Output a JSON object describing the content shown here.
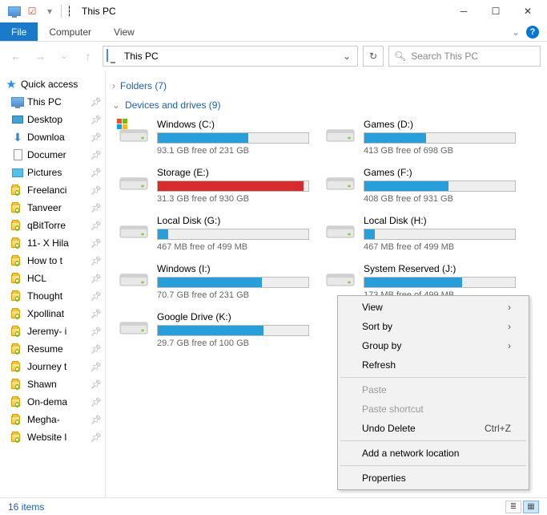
{
  "window": {
    "title": "This PC"
  },
  "ribbon": {
    "file": "File",
    "computer": "Computer",
    "view": "View"
  },
  "nav": {
    "address": "This PC",
    "search_placeholder": "Search This PC"
  },
  "sidebar": {
    "quick_access": "Quick access",
    "items": [
      {
        "label": "This PC",
        "type": "pc",
        "pin": true
      },
      {
        "label": "Desktop",
        "type": "desktop",
        "pin": true
      },
      {
        "label": "Downloa",
        "type": "down",
        "pin": true
      },
      {
        "label": "Documer",
        "type": "doc",
        "pin": true
      },
      {
        "label": "Pictures",
        "type": "pic",
        "pin": true
      },
      {
        "label": "Freelanci",
        "type": "folder",
        "pin": true
      },
      {
        "label": "Tanveer",
        "type": "folder",
        "pin": true
      },
      {
        "label": "qBitTorre",
        "type": "folder",
        "pin": true
      },
      {
        "label": "11- X Hila",
        "type": "folder",
        "pin": true
      },
      {
        "label": "How to t",
        "type": "folder",
        "pin": true
      },
      {
        "label": "HCL",
        "type": "folder",
        "pin": true
      },
      {
        "label": "Thought",
        "type": "folder",
        "pin": true
      },
      {
        "label": "Xpollinat",
        "type": "folder",
        "pin": true
      },
      {
        "label": "Jeremy- i",
        "type": "folder",
        "pin": true
      },
      {
        "label": "Resume",
        "type": "folder",
        "pin": true
      },
      {
        "label": "Journey t",
        "type": "folder",
        "pin": true
      },
      {
        "label": "Shawn",
        "type": "folder",
        "pin": true
      },
      {
        "label": "On-dema",
        "type": "folder",
        "pin": true
      },
      {
        "label": "Megha-",
        "type": "folder",
        "pin": true
      },
      {
        "label": "Website l",
        "type": "folder",
        "pin": true
      }
    ]
  },
  "groups": {
    "folders": {
      "header": "Folders (7)"
    },
    "drives": {
      "header": "Devices and drives (9)",
      "items": [
        {
          "name": "Windows (C:)",
          "free": "93.1 GB free of 231 GB",
          "fill": 60,
          "color": "#26a0da",
          "os": true
        },
        {
          "name": "Games (D:)",
          "free": "413 GB free of 698 GB",
          "fill": 41,
          "color": "#26a0da"
        },
        {
          "name": "Storage (E:)",
          "free": "31.3 GB free of 930 GB",
          "fill": 97,
          "color": "#d92b2b"
        },
        {
          "name": "Games (F:)",
          "free": "408 GB free of 931 GB",
          "fill": 56,
          "color": "#26a0da"
        },
        {
          "name": "Local Disk (G:)",
          "free": "467 MB free of 499 MB",
          "fill": 7,
          "color": "#26a0da"
        },
        {
          "name": "Local Disk (H:)",
          "free": "467 MB free of 499 MB",
          "fill": 7,
          "color": "#26a0da"
        },
        {
          "name": "Windows (I:)",
          "free": "70.7 GB free of 231 GB",
          "fill": 69,
          "color": "#26a0da"
        },
        {
          "name": "System Reserved (J:)",
          "free": "173 MB free of 499 MB",
          "fill": 65,
          "color": "#26a0da"
        },
        {
          "name": "Google Drive (K:)",
          "free": "29.7 GB free of 100 GB",
          "fill": 70,
          "color": "#26a0da"
        }
      ]
    }
  },
  "context_menu": [
    {
      "label": "View",
      "submenu": true
    },
    {
      "label": "Sort by",
      "submenu": true
    },
    {
      "label": "Group by",
      "submenu": true
    },
    {
      "label": "Refresh"
    },
    {
      "sep": true
    },
    {
      "label": "Paste",
      "disabled": true
    },
    {
      "label": "Paste shortcut",
      "disabled": true
    },
    {
      "label": "Undo Delete",
      "hotkey": "Ctrl+Z"
    },
    {
      "sep": true
    },
    {
      "label": "Add a network location"
    },
    {
      "sep": true
    },
    {
      "label": "Properties"
    }
  ],
  "status": {
    "text": "16 items"
  }
}
